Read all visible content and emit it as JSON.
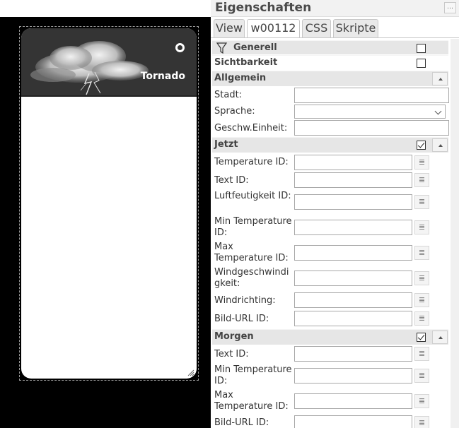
{
  "widget": {
    "label": "Tornado",
    "icon": "thunderstorm-cloud-image"
  },
  "panel": {
    "title": "Eigenschaften",
    "menu_icon": "panel-menu-icon",
    "tabs": [
      {
        "label": "View",
        "active": false
      },
      {
        "label": "w00112",
        "active": true
      },
      {
        "label": "CSS",
        "active": false
      },
      {
        "label": "Skripte",
        "active": false
      }
    ]
  },
  "sections": {
    "generell": {
      "label": "Generell",
      "checked": false
    },
    "sichtbarkeit": {
      "label": "Sichtbarkeit",
      "checked": false
    },
    "allgemein": {
      "label": "Allgemein"
    },
    "jetzt": {
      "label": "Jetzt",
      "checked": true
    },
    "morgen": {
      "label": "Morgen",
      "checked": true
    }
  },
  "allgemein_fields": [
    {
      "label": "Stadt:",
      "value": ""
    },
    {
      "label": "Sprache:",
      "value": ""
    },
    {
      "label": "Geschw.Einheit:",
      "value": ""
    }
  ],
  "jetzt_fields": [
    {
      "label": "Temperature ID:",
      "value": ""
    },
    {
      "label": "Text ID:",
      "value": ""
    },
    {
      "label": "Luftfeutigkeit ID:",
      "value": ""
    },
    {
      "label": "Min Temperature ID:",
      "value": ""
    },
    {
      "label": "Max Temperature ID:",
      "value": ""
    },
    {
      "label": "Windgeschwindigkeit:",
      "value": ""
    },
    {
      "label": "Windrichting:",
      "value": ""
    },
    {
      "label": "Bild-URL ID:",
      "value": ""
    }
  ],
  "morgen_fields": [
    {
      "label": "Text ID:",
      "value": ""
    },
    {
      "label": "Min Temperature ID:",
      "value": ""
    },
    {
      "label": "Max Temperature ID:",
      "value": ""
    },
    {
      "label": "Bild-URL ID:",
      "value": ""
    }
  ]
}
